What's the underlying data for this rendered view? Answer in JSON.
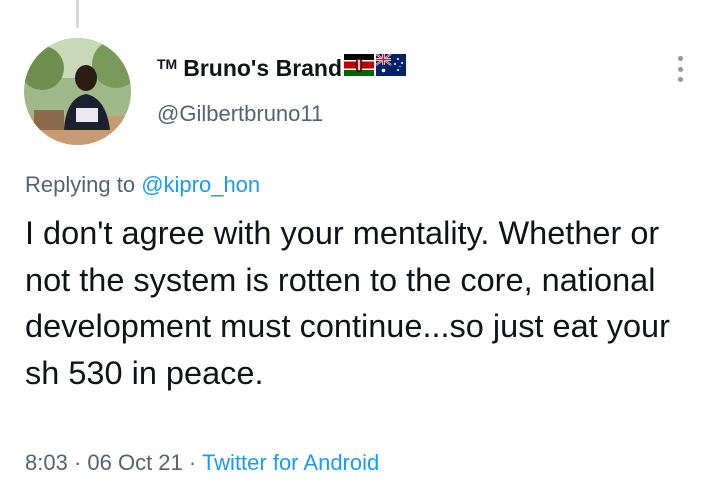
{
  "author": {
    "tm_mark": "TM",
    "display_name": "Bruno's Brand",
    "flag_icons": [
      "kenya-flag-icon",
      "australia-flag-icon"
    ],
    "handle": "@Gilbertbruno11"
  },
  "reply": {
    "prefix": "Replying to ",
    "handle": "@kipro_hon"
  },
  "tweet": {
    "text": "I don't agree with your mentality. Whether or not the system is rotten to the core, national development must continue...so just eat your sh 530 in peace."
  },
  "meta": {
    "time": "8:03",
    "sep1": " · ",
    "date": "06 Oct 21",
    "sep2": " · ",
    "source": "Twitter for Android"
  },
  "colors": {
    "text": "#0f1419",
    "secondary": "#536471",
    "link": "#1d9bf0",
    "thread_line": "#cfd9de"
  }
}
